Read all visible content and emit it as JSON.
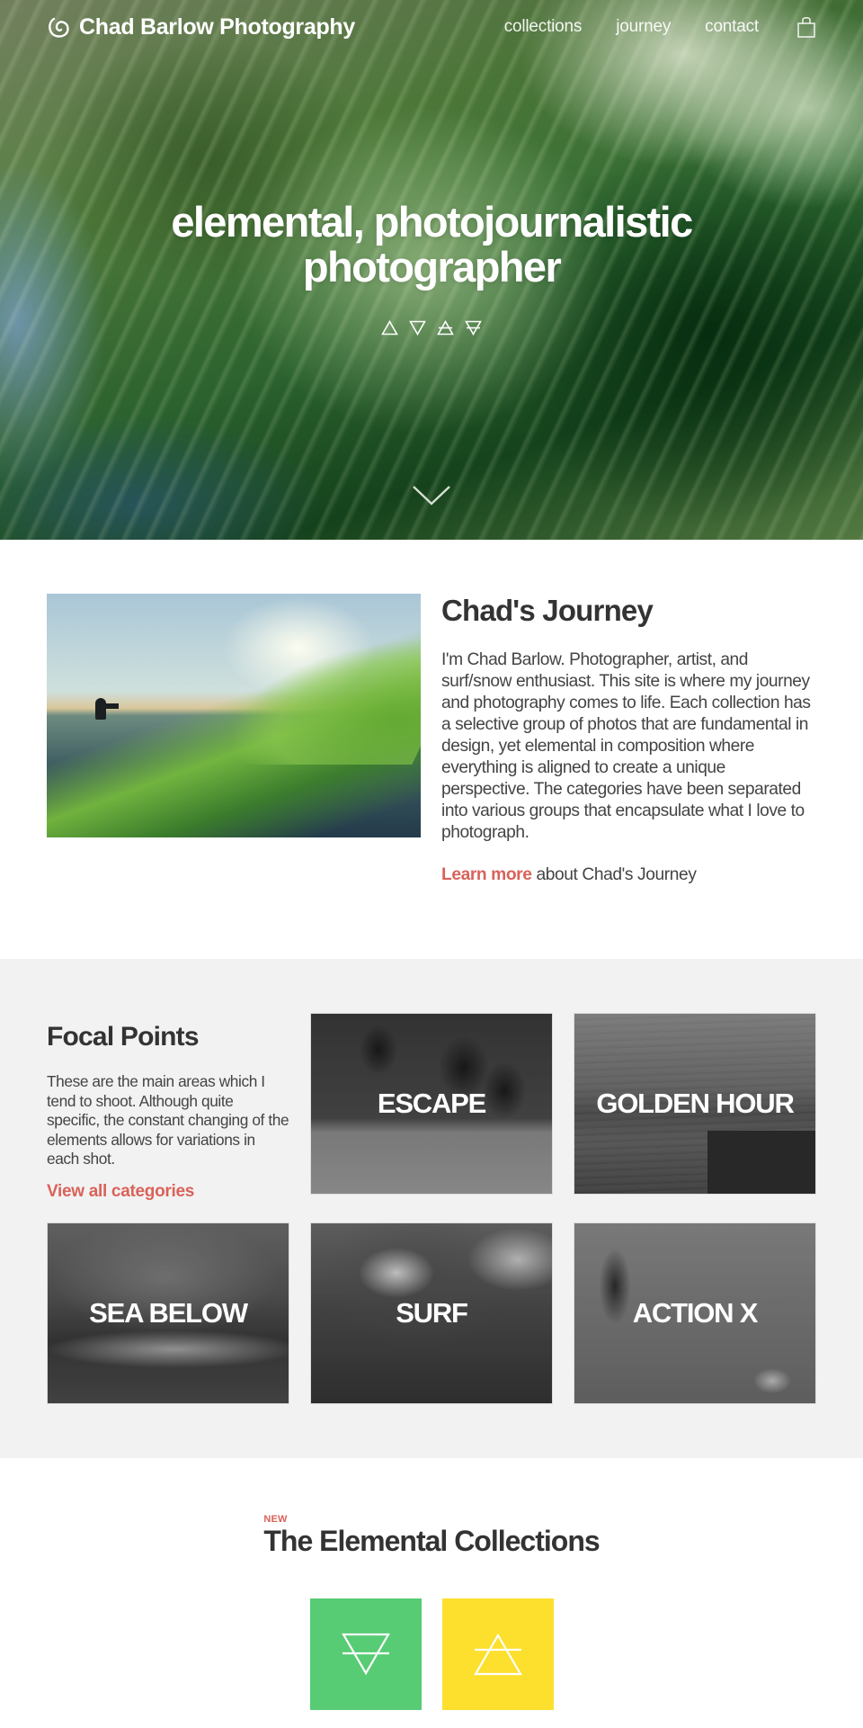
{
  "nav": {
    "brand": "Chad Barlow Photography",
    "brand_icon": "spiral-logo-icon",
    "links": [
      {
        "label": "collections"
      },
      {
        "label": "journey"
      },
      {
        "label": "contact"
      }
    ],
    "cart_icon": "shopping-bag-icon"
  },
  "hero": {
    "title_line1": "elemental, photojournalistic",
    "title_line2": "photographer",
    "elements": [
      "fire-triangle-icon",
      "water-triangle-icon",
      "air-triangle-icon",
      "earth-triangle-icon"
    ],
    "scroll_icon": "chevron-down-icon"
  },
  "journey": {
    "title": "Chad's Journey",
    "body": "I'm Chad Barlow. Photographer, artist, and surf/snow enthusiast. This site is where my journey and photography comes to life. Each collection has a selective group of photos that are fundamental in design, yet elemental in composition where everything is aligned to create a unique perspective. The categories have been separated into various groups that encapsulate what I love to photograph.",
    "cta_link": "Learn more",
    "cta_rest": "about Chad's Journey"
  },
  "focal": {
    "title": "Focal Points",
    "body": "These are the main areas which I tend to shoot. Although quite specific, the constant changing of the elements allows for variations in each shot.",
    "view_all": "View all categories",
    "categories": [
      {
        "label": "Escape"
      },
      {
        "label": "Golden Hour"
      },
      {
        "label": "Sea Below"
      },
      {
        "label": "Surf"
      },
      {
        "label": "Action X"
      }
    ]
  },
  "collections": {
    "badge": "NEW",
    "title": "The Elemental Collections",
    "items": [
      {
        "element": "earth",
        "color": "#58cb75"
      },
      {
        "element": "air",
        "color": "#fddf2e"
      }
    ]
  },
  "colors": {
    "accent": "#d9625a",
    "text": "#333333",
    "focal_bg": "#f2f2f2"
  }
}
